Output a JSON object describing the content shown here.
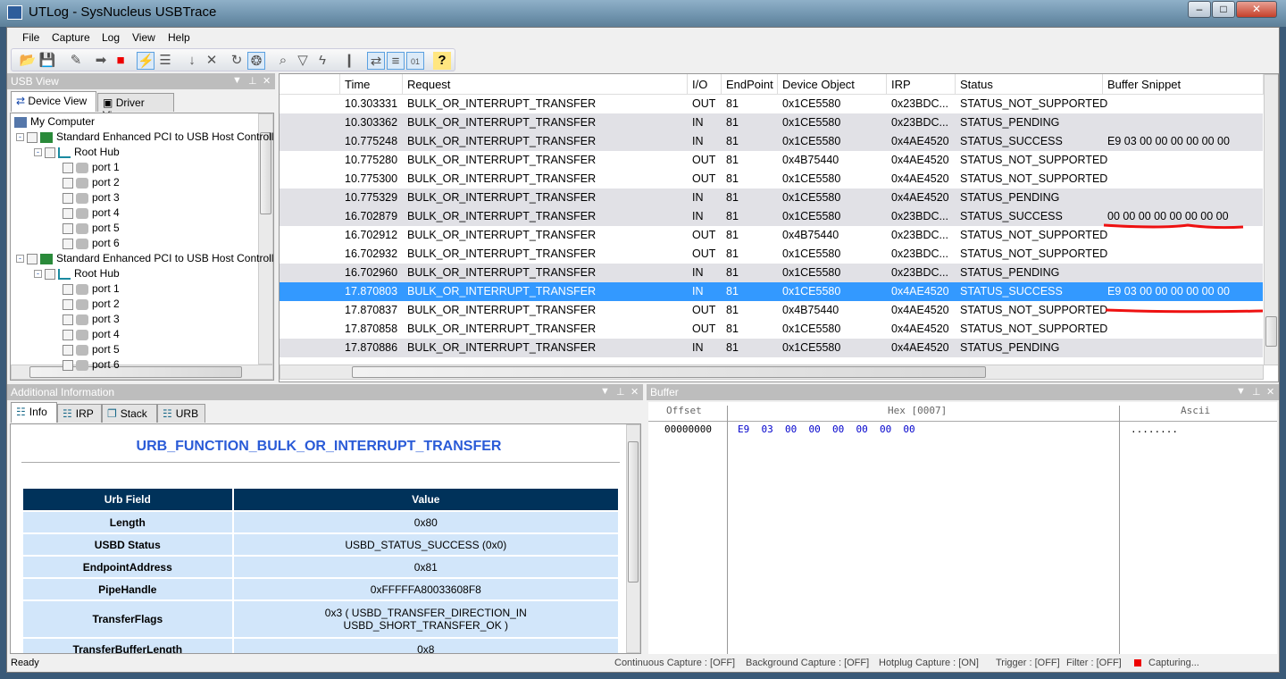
{
  "window": {
    "title": "UTLog - SysNucleus USBTrace",
    "controls": [
      "minimize",
      "maximize",
      "close"
    ]
  },
  "menu": [
    "File",
    "Capture",
    "Log",
    "View",
    "Help"
  ],
  "toolbar": [
    {
      "icon": "open-icon"
    },
    {
      "icon": "save-icon"
    },
    {
      "icon": "pencil-icon"
    },
    {
      "icon": "start-capture-icon"
    },
    {
      "icon": "stop-capture-icon"
    },
    {
      "icon": "plug-icon",
      "active": true
    },
    {
      "icon": "list-icon"
    },
    {
      "icon": "down-arrow-icon"
    },
    {
      "icon": "clear-icon"
    },
    {
      "icon": "refresh-icon"
    },
    {
      "icon": "bulb-icon",
      "active": true
    },
    {
      "icon": "find-icon"
    },
    {
      "icon": "filter-icon"
    },
    {
      "icon": "trigger-icon"
    },
    {
      "icon": "stats-icon"
    },
    {
      "icon": "usb-icon",
      "active": true
    },
    {
      "icon": "log-icon",
      "active": true
    },
    {
      "icon": "hex-icon",
      "active": true
    },
    {
      "icon": "help-icon"
    }
  ],
  "usb_view": {
    "title": "USB View",
    "tabs": [
      "Device View",
      "Driver View"
    ],
    "tree": {
      "root": "My Computer",
      "controllers": [
        {
          "label": "Standard Enhanced PCI to USB Host Controlle",
          "hub": "Root Hub",
          "ports": [
            "port 1",
            "port 2",
            "port 3",
            "port 4",
            "port 5",
            "port 6"
          ]
        },
        {
          "label": "Standard Enhanced PCI to USB Host Controlle",
          "hub": "Root Hub",
          "ports": [
            "port 1",
            "port 2",
            "port 3",
            "port 4",
            "port 5",
            "port 6"
          ]
        }
      ]
    }
  },
  "grid": {
    "columns": [
      "Time",
      "Request",
      "I/O",
      "EndPoint",
      "Device Object",
      "IRP",
      "Status",
      "Buffer Snippet"
    ],
    "selected_row": 10,
    "rows": [
      [
        "10.303331",
        "BULK_OR_INTERRUPT_TRANSFER",
        "OUT",
        "81",
        "0x1CE5580",
        "0x23BDC...",
        "STATUS_NOT_SUPPORTED",
        ""
      ],
      [
        "10.303362",
        "BULK_OR_INTERRUPT_TRANSFER",
        "IN",
        "81",
        "0x1CE5580",
        "0x23BDC...",
        "STATUS_PENDING",
        ""
      ],
      [
        "10.775248",
        "BULK_OR_INTERRUPT_TRANSFER",
        "IN",
        "81",
        "0x1CE5580",
        "0x4AE4520",
        "STATUS_SUCCESS",
        "E9 03 00 00 00 00 00 00"
      ],
      [
        "10.775280",
        "BULK_OR_INTERRUPT_TRANSFER",
        "OUT",
        "81",
        "0x4B75440",
        "0x4AE4520",
        "STATUS_NOT_SUPPORTED",
        ""
      ],
      [
        "10.775300",
        "BULK_OR_INTERRUPT_TRANSFER",
        "OUT",
        "81",
        "0x1CE5580",
        "0x4AE4520",
        "STATUS_NOT_SUPPORTED",
        ""
      ],
      [
        "10.775329",
        "BULK_OR_INTERRUPT_TRANSFER",
        "IN",
        "81",
        "0x1CE5580",
        "0x4AE4520",
        "STATUS_PENDING",
        ""
      ],
      [
        "16.702879",
        "BULK_OR_INTERRUPT_TRANSFER",
        "IN",
        "81",
        "0x1CE5580",
        "0x23BDC...",
        "STATUS_SUCCESS",
        "00 00 00 00 00 00 00 00"
      ],
      [
        "16.702912",
        "BULK_OR_INTERRUPT_TRANSFER",
        "OUT",
        "81",
        "0x4B75440",
        "0x23BDC...",
        "STATUS_NOT_SUPPORTED",
        ""
      ],
      [
        "16.702932",
        "BULK_OR_INTERRUPT_TRANSFER",
        "OUT",
        "81",
        "0x1CE5580",
        "0x23BDC...",
        "STATUS_NOT_SUPPORTED",
        ""
      ],
      [
        "16.702960",
        "BULK_OR_INTERRUPT_TRANSFER",
        "IN",
        "81",
        "0x1CE5580",
        "0x23BDC...",
        "STATUS_PENDING",
        ""
      ],
      [
        "17.870803",
        "BULK_OR_INTERRUPT_TRANSFER",
        "IN",
        "81",
        "0x1CE5580",
        "0x4AE4520",
        "STATUS_SUCCESS",
        "E9 03 00 00 00 00 00 00"
      ],
      [
        "17.870837",
        "BULK_OR_INTERRUPT_TRANSFER",
        "OUT",
        "81",
        "0x4B75440",
        "0x4AE4520",
        "STATUS_NOT_SUPPORTED",
        ""
      ],
      [
        "17.870858",
        "BULK_OR_INTERRUPT_TRANSFER",
        "OUT",
        "81",
        "0x1CE5580",
        "0x4AE4520",
        "STATUS_NOT_SUPPORTED",
        ""
      ],
      [
        "17.870886",
        "BULK_OR_INTERRUPT_TRANSFER",
        "IN",
        "81",
        "0x1CE5580",
        "0x4AE4520",
        "STATUS_PENDING",
        ""
      ]
    ]
  },
  "info": {
    "title": "Additional Information",
    "tabs": [
      "Info",
      "IRP",
      "Stack",
      "URB"
    ],
    "heading": "URB_FUNCTION_BULK_OR_INTERRUPT_TRANSFER",
    "headers": [
      "Urb Field",
      "Value"
    ],
    "rows": [
      [
        "Length",
        "0x80"
      ],
      [
        "USBD Status",
        "USBD_STATUS_SUCCESS (0x0)"
      ],
      [
        "EndpointAddress",
        "0x81"
      ],
      [
        "PipeHandle",
        "0xFFFFFA80033608F8"
      ],
      [
        "TransferFlags",
        "0x3 ( USBD_TRANSFER_DIRECTION_IN\nUSBD_SHORT_TRANSFER_OK )"
      ],
      [
        "TransferBufferLength",
        "0x8"
      ]
    ]
  },
  "buffer": {
    "title": "Buffer",
    "headers": [
      "Offset",
      "Hex [0007]",
      "Ascii"
    ],
    "rows": [
      [
        "00000000",
        "E9  03  00  00  00  00  00  00",
        "........"
      ]
    ]
  },
  "status": {
    "ready": "Ready",
    "items": [
      "Continuous Capture : [OFF]",
      "Background Capture : [OFF]",
      "Hotplug Capture : [ON]",
      "Trigger : [OFF]",
      "Filter :  [OFF]"
    ],
    "capturing": "Capturing...",
    "capture_color": "#ee0000"
  },
  "colors": {
    "selection": "#3399ff",
    "heading": "#2a5bd7",
    "table_header": "#00325a",
    "table_cell": "#d2e6fa",
    "hex_text": "#0000cc",
    "annotation": "#ee1111"
  }
}
